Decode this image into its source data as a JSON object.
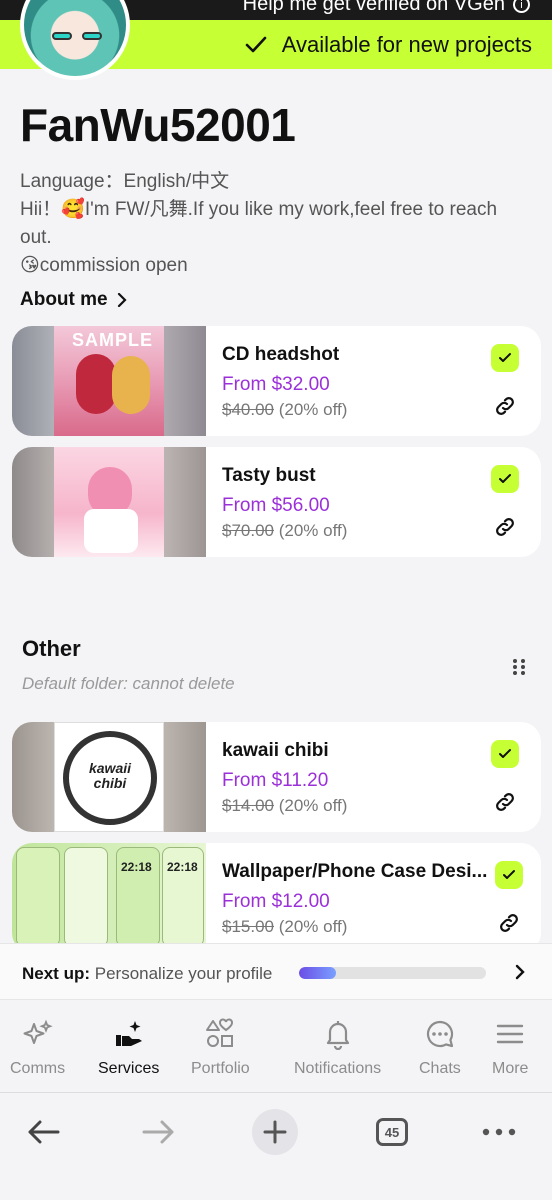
{
  "banner": {
    "verify_text": "Help me get verified on VGen",
    "available_text": "Available for new projects"
  },
  "profile": {
    "username": "FanWu52001",
    "bio_line1": "Language：English/中文",
    "bio_line2": "Hii！🥰I'm FW/凡舞.If you like my work,feel free to reach out.",
    "bio_line3": "😘commission open",
    "about_label": "About me"
  },
  "services": [
    {
      "title": "CD headshot",
      "price": "From $32.00",
      "old_price": "$40.00",
      "discount": "(20% off)",
      "thumb_label": "SAMPLE"
    },
    {
      "title": "Tasty bust",
      "price": "From $56.00",
      "old_price": "$70.00",
      "discount": "(20% off)"
    }
  ],
  "folder": {
    "title": "Other",
    "subtitle": "Default folder: cannot delete",
    "services": [
      {
        "title": "kawaii chibi",
        "price": "From $11.20",
        "old_price": "$14.00",
        "discount": "(20% off)",
        "thumb_label": "kawaii chibi"
      },
      {
        "title": "Wallpaper/Phone Case Desi...",
        "price": "From $12.00",
        "old_price": "$15.00",
        "discount": "(20% off)",
        "thumb_time": "22:18"
      }
    ]
  },
  "next_up": {
    "label": "Next up:",
    "text": "Personalize your profile",
    "progress": 0.2
  },
  "nav": {
    "items": [
      {
        "label": "Comms",
        "icon": "sparkles-icon"
      },
      {
        "label": "Services",
        "icon": "hand-sparkle-icon"
      },
      {
        "label": "Portfolio",
        "icon": "shapes-icon"
      },
      {
        "label": "Notifications",
        "icon": "bell-icon"
      },
      {
        "label": "Chats",
        "icon": "chat-bubble-icon"
      },
      {
        "label": "More",
        "icon": "menu-icon"
      }
    ],
    "active": "Services"
  },
  "browser": {
    "tab_count": "45"
  },
  "colors": {
    "accent": "#c6ff33",
    "price": "#9b30d9",
    "text": "#111111"
  }
}
